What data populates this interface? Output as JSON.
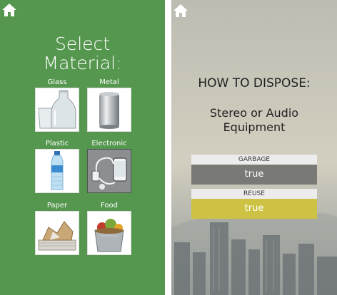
{
  "material_screen": {
    "title_line1": "Select",
    "title_line2": "Material:",
    "materials": [
      {
        "label": "Glass"
      },
      {
        "label": "Metal"
      },
      {
        "label": "Plastic"
      },
      {
        "label": "Electronic",
        "selected": true
      },
      {
        "label": "Paper"
      },
      {
        "label": "Food"
      }
    ],
    "home_icon": "home-icon",
    "background_color": "#55974f"
  },
  "dispose_screen": {
    "title": "HOW TO DISPOSE:",
    "item_line1": "Stereo or Audio",
    "item_line2": "Equipment",
    "home_icon": "home-icon",
    "categories": [
      {
        "label": "GARBAGE",
        "value": "true",
        "color": "#797a76"
      },
      {
        "label": "REUSE",
        "value": "true",
        "color": "#cdc244"
      }
    ]
  }
}
